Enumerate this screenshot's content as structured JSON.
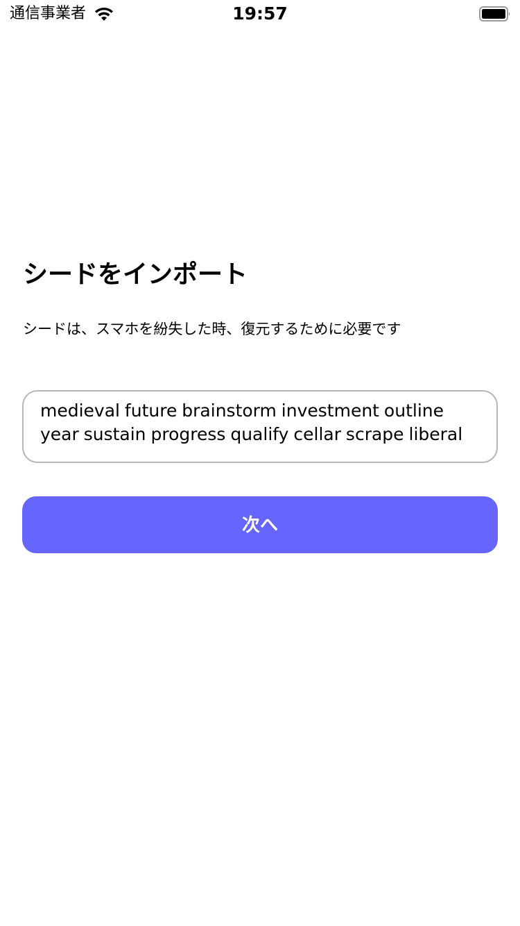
{
  "status_bar": {
    "carrier": "通信事業者",
    "time": "19:57",
    "wifi_icon": "wifi-icon",
    "battery_icon": "battery-icon"
  },
  "main": {
    "title": "シードをインポート",
    "description": "シードは、スマホを紛失した時、復元するために必要です",
    "seed_input": {
      "value": "medieval future brainstorm investment outline year sustain progress qualify cellar scrape liberal"
    },
    "next_button_label": "次へ"
  },
  "colors": {
    "accent": "#6666ff",
    "field_border": "#b5b5b5",
    "background": "#ffffff"
  }
}
